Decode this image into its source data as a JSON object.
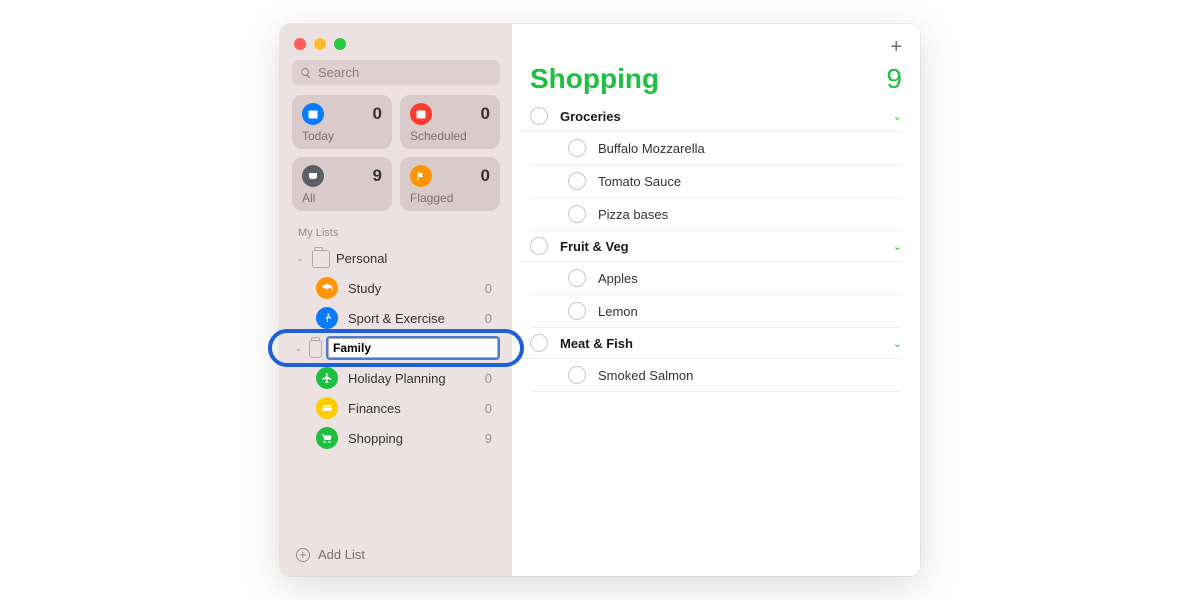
{
  "search": {
    "placeholder": "Search"
  },
  "smart": [
    {
      "label": "Today",
      "count": 0,
      "color": "#0a7aff"
    },
    {
      "label": "Scheduled",
      "count": 0,
      "color": "#ff3b30"
    },
    {
      "label": "All",
      "count": 9,
      "color": "#5b6066"
    },
    {
      "label": "Flagged",
      "count": 0,
      "color": "#ff9500"
    }
  ],
  "sidebar": {
    "sectionLabel": "My Lists",
    "groups": [
      {
        "name": "Personal",
        "editing": false,
        "lists": [
          {
            "name": "Study",
            "count": 0,
            "color": "#ff9500",
            "icon": "grad"
          },
          {
            "name": "Sport & Exercise",
            "count": 0,
            "color": "#0a7aff",
            "icon": "run"
          }
        ]
      },
      {
        "name": "Family",
        "editing": true,
        "lists": [
          {
            "name": "Holiday Planning",
            "count": 0,
            "color": "#1fbf3f",
            "icon": "plane"
          },
          {
            "name": "Finances",
            "count": 0,
            "color": "#ffcc00",
            "icon": "card"
          },
          {
            "name": "Shopping",
            "count": 9,
            "color": "#1fbf3f",
            "icon": "cart"
          }
        ]
      }
    ],
    "addList": "Add List"
  },
  "main": {
    "title": "Shopping",
    "count": 9,
    "sections": [
      {
        "name": "Groceries",
        "items": [
          "Buffalo Mozzarella",
          "Tomato Sauce",
          "Pizza bases"
        ]
      },
      {
        "name": "Fruit & Veg",
        "items": [
          "Apples",
          "Lemon"
        ]
      },
      {
        "name": "Meat & Fish",
        "items": [
          "Smoked Salmon"
        ]
      }
    ]
  }
}
